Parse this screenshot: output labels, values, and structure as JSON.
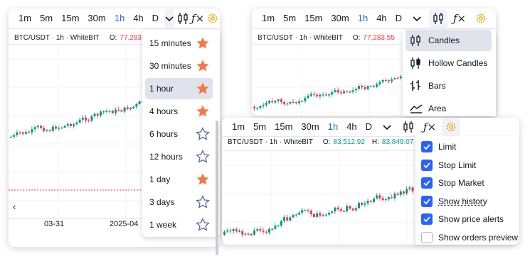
{
  "colors": {
    "accent": "#2962ff",
    "up": "#089981",
    "down": "#f23645",
    "star_on": "#f7774a",
    "star_off": "#5b6a9a"
  },
  "toolbar": {
    "timeframes": [
      "1m",
      "5m",
      "15m",
      "30m",
      "1h",
      "4h",
      "D"
    ],
    "active_timeframe": "1h",
    "fx_label": "ƒ×"
  },
  "legend": {
    "symbol": "BTC/USDT · 1h · WhiteBIT",
    "open_label": "O:",
    "open_value_left": "77,283.5",
    "open_value_mid": "77,283.55",
    "open_value_bottom": "83,512.92",
    "high_label": "H:",
    "high_value_bottom": "83,849.07"
  },
  "panel1": {
    "x_labels": [
      "03-31",
      "2025-04"
    ],
    "scroll_left_label": "‹"
  },
  "timeframe_menu": {
    "items": [
      {
        "label": "15 minutes",
        "favorite": true
      },
      {
        "label": "30 minutes",
        "favorite": true
      },
      {
        "label": "1 hour",
        "favorite": true,
        "selected": true
      },
      {
        "label": "4 hours",
        "favorite": true
      },
      {
        "label": "6 hours",
        "favorite": false
      },
      {
        "label": "12 hours",
        "favorite": false
      },
      {
        "label": "1 day",
        "favorite": true
      },
      {
        "label": "3 days",
        "favorite": false
      },
      {
        "label": "1 week",
        "favorite": false
      }
    ]
  },
  "chart_type_menu": {
    "items": [
      {
        "label": "Candles",
        "icon": "candles-icon",
        "selected": true
      },
      {
        "label": "Hollow Candles",
        "icon": "hollow-candles-icon"
      },
      {
        "label": "Bars",
        "icon": "bars-icon"
      },
      {
        "label": "Area",
        "icon": "area-icon"
      }
    ]
  },
  "settings_menu": {
    "items": [
      {
        "label": "Limit",
        "checked": true
      },
      {
        "label": "Stop Limit",
        "checked": true
      },
      {
        "label": "Stop Market",
        "checked": true
      },
      {
        "label": "Show history",
        "checked": true,
        "underline": true
      },
      {
        "label": "Show price alerts",
        "checked": true
      },
      {
        "label": "Show orders preview",
        "checked": false
      }
    ]
  }
}
